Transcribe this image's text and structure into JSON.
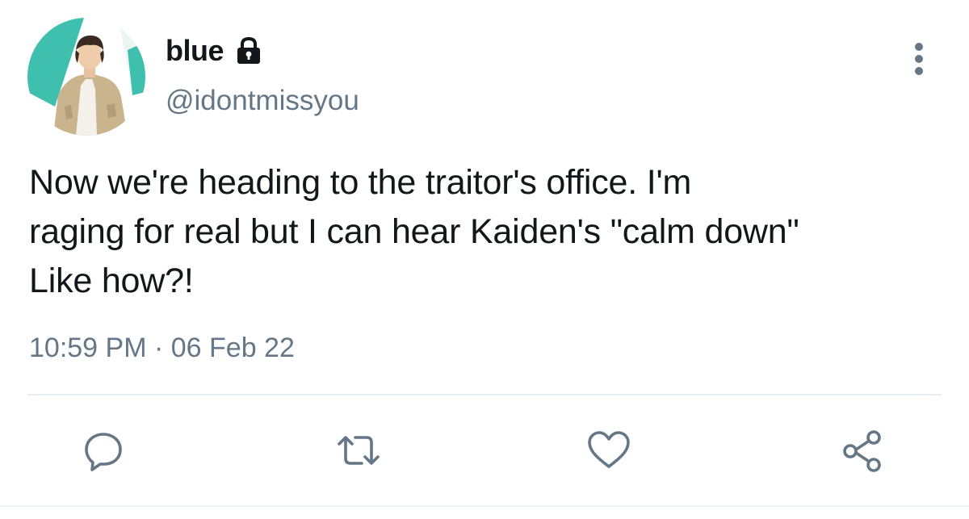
{
  "tweet": {
    "display_name": "blue",
    "handle": "@idontmissyou",
    "protected_icon": "lock-icon",
    "text": "Now we're heading to the traitor's office. I'm\nraging for real but I can hear Kaiden's \"calm down\"\nLike how?!",
    "time": "10:59 PM",
    "separator": " · ",
    "date": "06 Feb 22"
  },
  "actions": [
    {
      "icon": "reply-icon"
    },
    {
      "icon": "retweet-icon"
    },
    {
      "icon": "like-icon"
    },
    {
      "icon": "share-icon"
    }
  ],
  "menu": {
    "icon": "more-vertical-icon"
  },
  "colors": {
    "text_primary": "#14171a",
    "text_secondary": "#657786",
    "icon": "#657786",
    "divider": "#e6ecf0",
    "avatar_accent": "#3fbfae"
  }
}
